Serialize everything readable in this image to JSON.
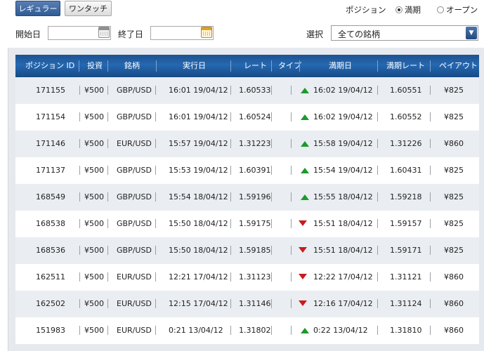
{
  "tabs": {
    "regular": "レギュラー",
    "one_touch": "ワンタッチ"
  },
  "position_filter": {
    "label": "ポジション",
    "options": [
      "満期",
      "オープン"
    ],
    "selected": "満期"
  },
  "date_filter": {
    "start_label": "開始日",
    "end_label": "終了日",
    "start_value": "",
    "end_value": ""
  },
  "symbol_filter": {
    "label": "選択",
    "value": "全ての銘柄"
  },
  "table": {
    "headers": [
      "ポジション ID",
      "投資",
      "銘柄",
      "実行日",
      "レート",
      "タイプ",
      "満期日",
      "満期レート",
      "ペイアウト"
    ],
    "rows": [
      {
        "id": "171155",
        "inv": "¥500",
        "sym": "GBP/USD",
        "exec": "16:01 19/04/12",
        "rate": "1.60533",
        "type": "up",
        "exp": "16:02 19/04/12",
        "exp_rate": "1.60551",
        "payout": "¥825"
      },
      {
        "id": "171154",
        "inv": "¥500",
        "sym": "GBP/USD",
        "exec": "16:01 19/04/12",
        "rate": "1.60524",
        "type": "up",
        "exp": "16:02 19/04/12",
        "exp_rate": "1.60552",
        "payout": "¥825"
      },
      {
        "id": "171146",
        "inv": "¥500",
        "sym": "EUR/USD",
        "exec": "15:57 19/04/12",
        "rate": "1.31223",
        "type": "up",
        "exp": "15:58 19/04/12",
        "exp_rate": "1.31226",
        "payout": "¥860"
      },
      {
        "id": "171137",
        "inv": "¥500",
        "sym": "GBP/USD",
        "exec": "15:53 19/04/12",
        "rate": "1.60391",
        "type": "up",
        "exp": "15:54 19/04/12",
        "exp_rate": "1.60431",
        "payout": "¥825"
      },
      {
        "id": "168549",
        "inv": "¥500",
        "sym": "GBP/USD",
        "exec": "15:54 18/04/12",
        "rate": "1.59196",
        "type": "up",
        "exp": "15:55 18/04/12",
        "exp_rate": "1.59218",
        "payout": "¥825"
      },
      {
        "id": "168538",
        "inv": "¥500",
        "sym": "GBP/USD",
        "exec": "15:50 18/04/12",
        "rate": "1.59175",
        "type": "down",
        "exp": "15:51 18/04/12",
        "exp_rate": "1.59157",
        "payout": "¥825"
      },
      {
        "id": "168536",
        "inv": "¥500",
        "sym": "GBP/USD",
        "exec": "15:50 18/04/12",
        "rate": "1.59185",
        "type": "down",
        "exp": "15:51 18/04/12",
        "exp_rate": "1.59171",
        "payout": "¥825"
      },
      {
        "id": "162511",
        "inv": "¥500",
        "sym": "EUR/USD",
        "exec": "12:21 17/04/12",
        "rate": "1.31123",
        "type": "down",
        "exp": "12:22 17/04/12",
        "exp_rate": "1.31121",
        "payout": "¥860"
      },
      {
        "id": "162502",
        "inv": "¥500",
        "sym": "EUR/USD",
        "exec": "12:15 17/04/12",
        "rate": "1.31146",
        "type": "down",
        "exp": "12:16 17/04/12",
        "exp_rate": "1.31124",
        "payout": "¥860"
      },
      {
        "id": "151983",
        "inv": "¥500",
        "sym": "EUR/USD",
        "exec": "0:21 13/04/12",
        "rate": "1.31802",
        "type": "up",
        "exp": "0:22 13/04/12",
        "exp_rate": "1.31810",
        "payout": "¥860"
      }
    ]
  },
  "colors": {
    "header_blue": "#2568b1",
    "up_green": "#1c9a2c",
    "down_red": "#c81c1c",
    "row_alt": "#eaedf1"
  },
  "icons": {
    "calendar": "calendar-icon",
    "dropdown": "chevron-down-icon",
    "up": "up-arrow-icon",
    "down": "down-arrow-icon"
  }
}
